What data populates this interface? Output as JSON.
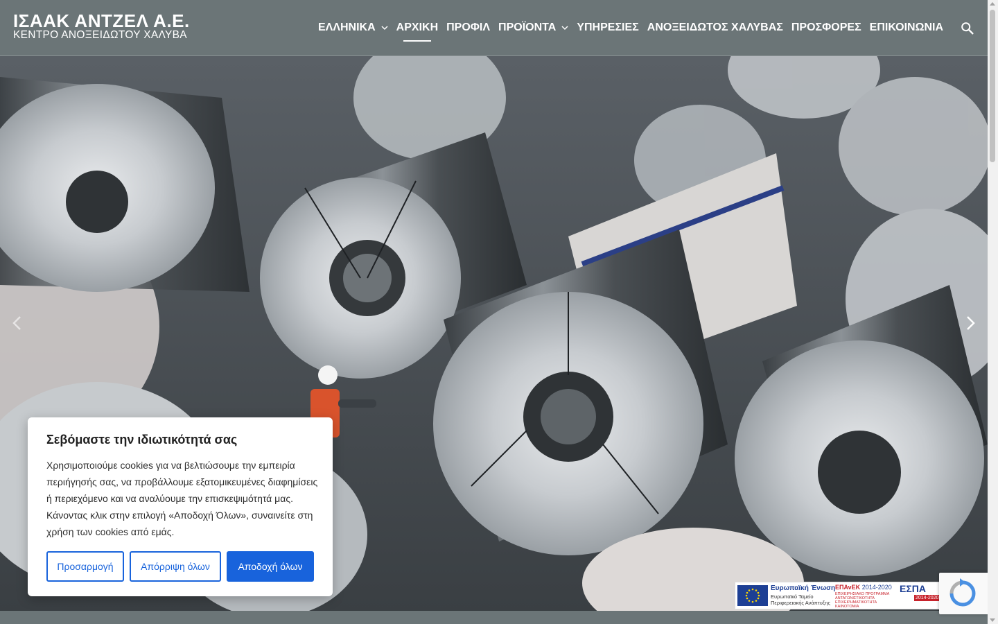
{
  "header": {
    "logo_title": "ΙΣΑΑΚ ΑΝΤΖΕΛ Α.Ε.",
    "logo_subtitle": "ΚΕΝΤΡΟ ΑΝΟΞΕΙΔΩΤΟΥ ΧΑΛΥΒΑ",
    "nav": [
      {
        "label": "ΕΛΛΗΝΙΚΑ",
        "dropdown": true
      },
      {
        "label": "ΑΡΧΙΚΗ",
        "active": true
      },
      {
        "label": "ΠΡΟΦΙΛ"
      },
      {
        "label": "ΠΡΟΪΟΝΤΑ",
        "dropdown": true
      },
      {
        "label": "ΥΠΗΡΕΣΙΕΣ"
      },
      {
        "label": "ΑΝΟΞΕΙΔΩΤΟΣ ΧΑΛΥΒΑΣ"
      },
      {
        "label": "ΠΡΟΣΦΟΡΕΣ"
      },
      {
        "label": "ΕΠΙΚΟΙΝΩΝΙΑ"
      }
    ],
    "search_icon": "search-icon"
  },
  "hero": {
    "image": "stainless steel coils with worker in hard hat",
    "prev_icon": "chevron-left-icon",
    "next_icon": "chevron-right-icon"
  },
  "cookie": {
    "title": "Σεβόμαστε την ιδιωτικότητά σας",
    "text": "Χρησιμοποιούμε cookies για να βελτιώσουμε την εμπειρία περιήγησής σας, να προβάλλουμε εξατομικευμένες διαφημίσεις ή περιεχόμενο και να αναλύουμε την επισκεψιμότητά μας. Κάνοντας κλικ στην επιλογή «Αποδοχή Όλων», συναινείτε στη χρήση των cookies από εμάς.",
    "customize": "Προσαρμογή",
    "reject": "Απόρριψη όλων",
    "accept": "Αποδοχή όλων"
  },
  "espa": {
    "eu_title": "Ευρωπαϊκή Ένωση",
    "eu_fund": "Ευρωπαϊκό Ταμείο Περιφερειακής Ανάπτυξης",
    "program": "ΕΠΑνΕΚ",
    "program_years": "2014-2020",
    "program_desc": "ΕΠΙΧΕΙΡΗΣΙΑΚΟ ΠΡΟΓΡΑΜΜΑ ΑΝΤΑΓΩΝΙΣΤΙΚΟΤΗΤΑ ΕΠΙΧΕΙΡΗΜΑΤΙΚΟΤΗΤΑ ΚΑΙΝΟΤΟΜΙΑ",
    "espa_label": "ΕΣΠΑ",
    "espa_years": "2014-2020"
  },
  "colors": {
    "header_bg": "#6b7577",
    "cookie_accent": "#1863dc"
  }
}
